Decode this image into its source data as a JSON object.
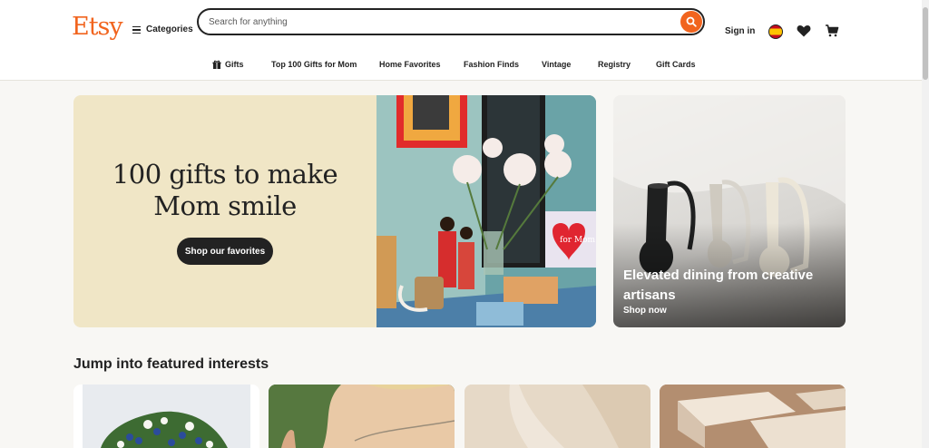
{
  "header": {
    "logo": "Etsy",
    "categories_label": "Categories",
    "search_placeholder": "Search for anything",
    "signin_label": "Sign in"
  },
  "subnav": [
    {
      "label": "Gifts",
      "icon": "gift-icon"
    },
    {
      "label": "Top 100 Gifts for Mom"
    },
    {
      "label": "Home Favorites"
    },
    {
      "label": "Fashion Finds"
    },
    {
      "label": "Vintage"
    },
    {
      "label": "Registry"
    },
    {
      "label": "Gift Cards"
    }
  ],
  "hero": {
    "title_line1": "100 gifts to make",
    "title_line2": "Mom smile",
    "button_label": "Shop our favorites",
    "card_text": "for Mom"
  },
  "side_banner": {
    "title": "Elevated dining from creative artisans",
    "link": "Shop now"
  },
  "featured": {
    "title": "Jump into featured interests"
  },
  "colors": {
    "brand": "#f1641e",
    "hero_bg": "#f0e6c6",
    "dark": "#222222"
  }
}
